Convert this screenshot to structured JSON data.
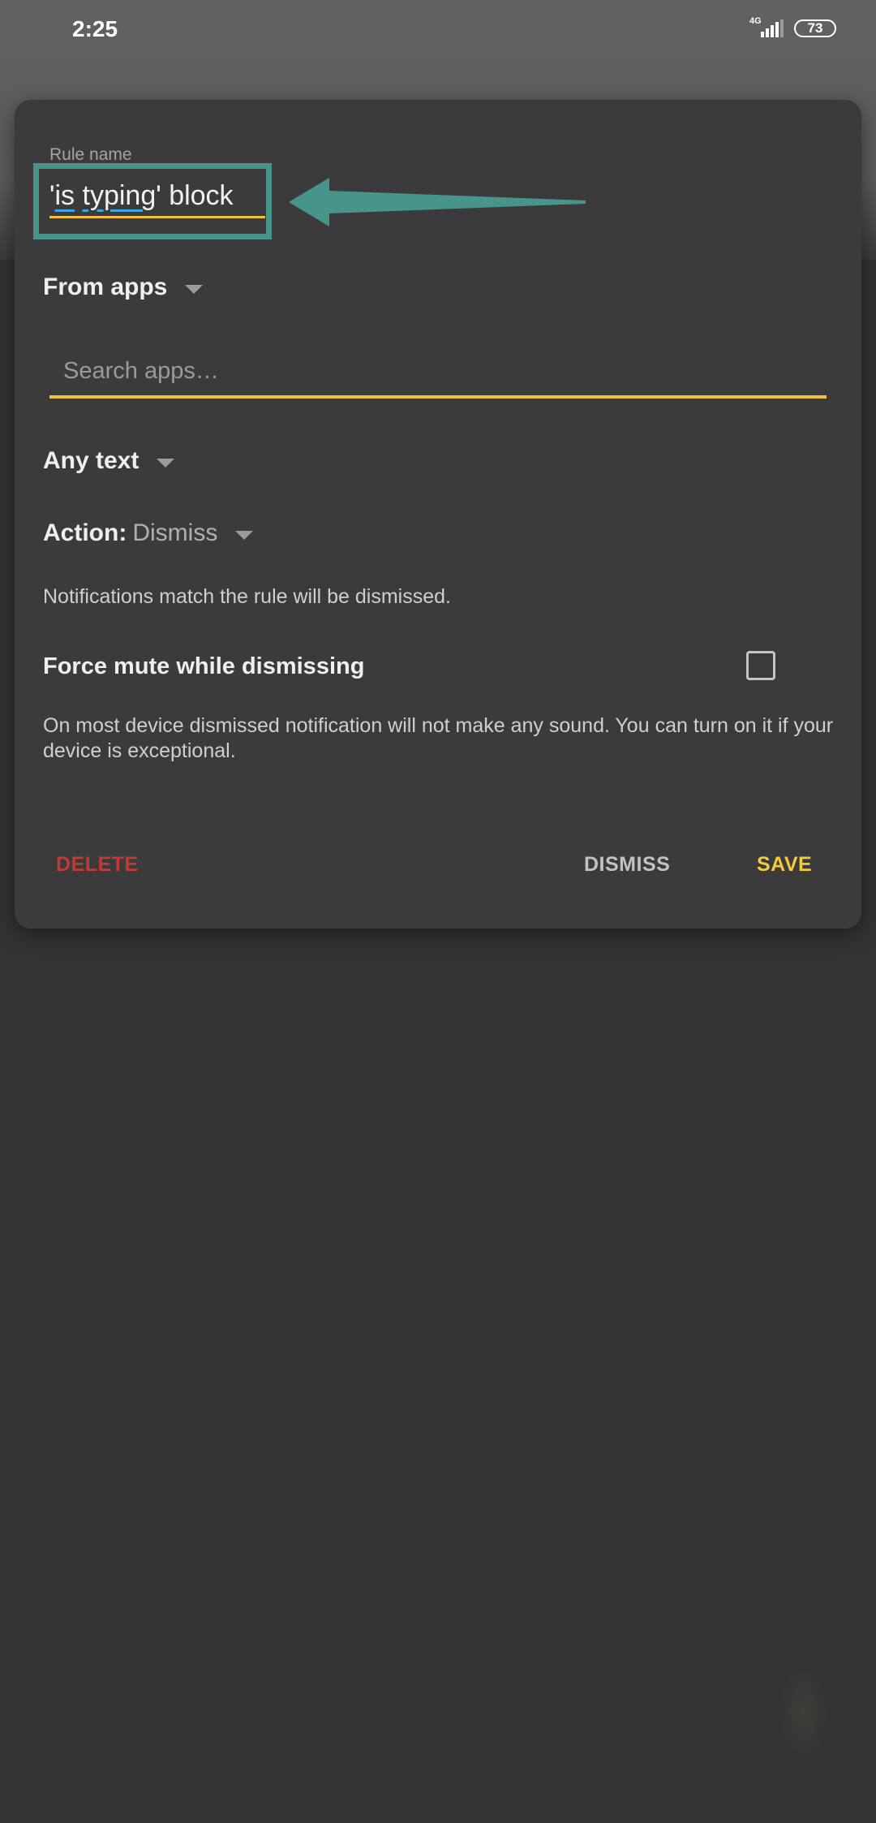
{
  "status_bar": {
    "time": "2:25",
    "network": "4G",
    "battery": "73"
  },
  "dialog": {
    "rule_name_label": "Rule name",
    "rule_name_value": {
      "part1": "'",
      "word1": "is",
      "space1": " ",
      "word2": "typing",
      "part2": "' block"
    },
    "from_apps_label": "From apps",
    "search_placeholder": "Search apps…",
    "text_filter_label": "Any text",
    "action_label": "Action:",
    "action_value": "Dismiss",
    "action_description": "Notifications match the rule will be dismissed.",
    "force_mute_label": "Force mute while dismissing",
    "force_mute_checked": false,
    "force_mute_description": "On most device dismissed notification will not make any sound. You can turn on it if your device is exceptional.",
    "buttons": {
      "delete": "DELETE",
      "dismiss": "DISMISS",
      "save": "SAVE"
    }
  },
  "colors": {
    "accent": "#f4bf3a",
    "delete": "#c03a36",
    "save": "#f1cb3c",
    "annotation": "#46948a"
  }
}
